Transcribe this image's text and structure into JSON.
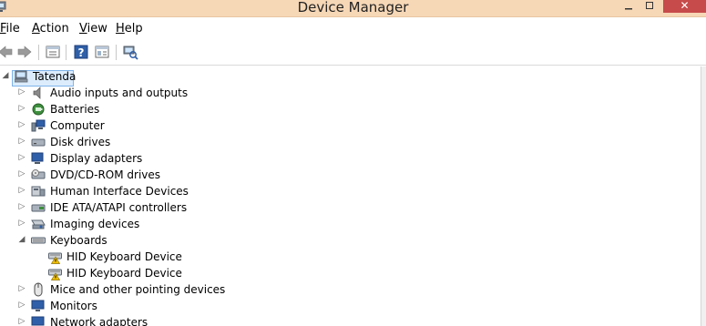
{
  "window": {
    "title": "Device Manager",
    "close_glyph": "✕"
  },
  "menu": {
    "file": "File",
    "action": "Action",
    "view": "View",
    "help": "Help"
  },
  "toolbar": {
    "icons": [
      "back-icon",
      "forward-icon",
      "properties-icon",
      "help-icon",
      "show-hide-console-tree-icon",
      "scan-hardware-icon"
    ]
  },
  "tree": {
    "root": {
      "label": "Tatenda",
      "icon": "computer-icon"
    },
    "items": [
      {
        "label": "Audio inputs and outputs",
        "icon": "speaker-icon"
      },
      {
        "label": "Batteries",
        "icon": "battery-icon"
      },
      {
        "label": "Computer",
        "icon": "computer-icon"
      },
      {
        "label": "Disk drives",
        "icon": "disk-drive-icon"
      },
      {
        "label": "Display adapters",
        "icon": "monitor-icon"
      },
      {
        "label": "DVD/CD-ROM drives",
        "icon": "dvd-drive-icon"
      },
      {
        "label": "Human Interface Devices",
        "icon": "hid-icon"
      },
      {
        "label": "IDE ATA/ATAPI controllers",
        "icon": "ide-controller-icon"
      },
      {
        "label": "Imaging devices",
        "icon": "camera-icon"
      },
      {
        "label": "Keyboards",
        "icon": "keyboard-icon"
      },
      {
        "label": "HID Keyboard Device",
        "icon": "keyboard-warning-icon"
      },
      {
        "label": "HID Keyboard Device",
        "icon": "keyboard-warning-icon"
      },
      {
        "label": "Mice and other pointing devices",
        "icon": "mouse-icon"
      },
      {
        "label": "Monitors",
        "icon": "monitor-icon"
      },
      {
        "label": "Network adapters",
        "icon": "network-adapter-icon"
      }
    ]
  },
  "colors": {
    "titlebar": "#f6d7b6",
    "close_button": "#c74b4b",
    "selection_fill": "#dcecfc",
    "selection_border": "#7eb4ea",
    "warning_yellow": "#f2c200"
  }
}
